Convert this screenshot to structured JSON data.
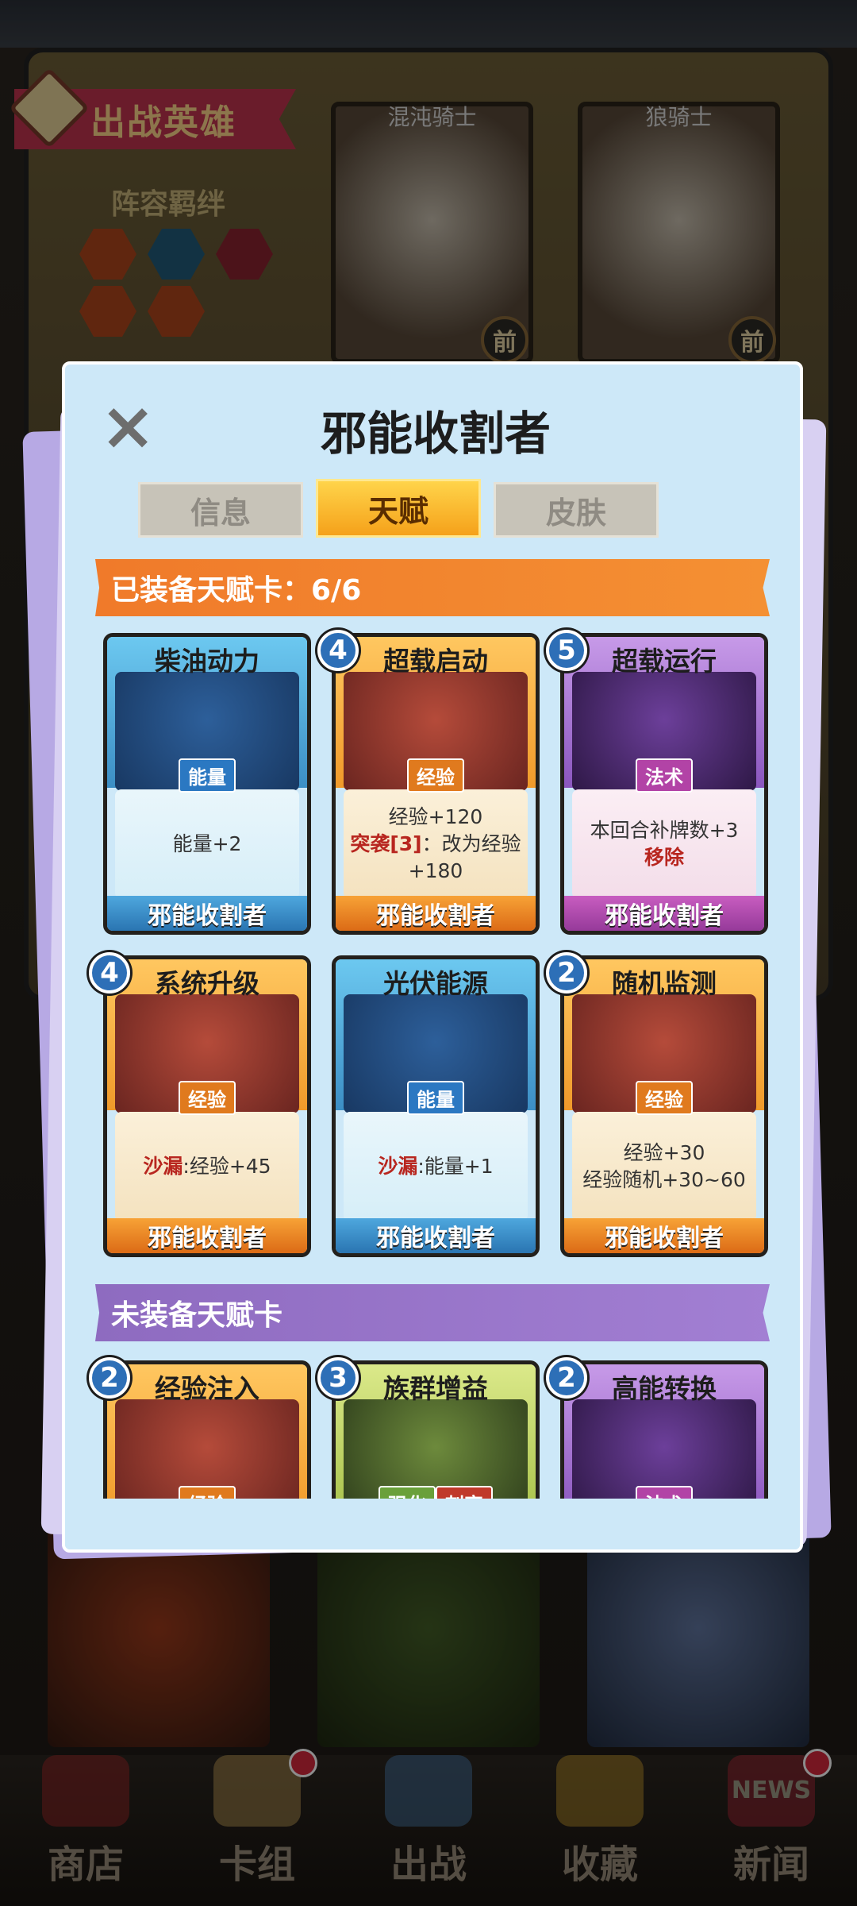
{
  "background": {
    "banner_label": "出战英雄",
    "team_bond_label": "阵容羁绊",
    "heroes": [
      {
        "name": "混沌骑士",
        "position_tag": "前"
      },
      {
        "name": "狼骑士",
        "position_tag": "前"
      }
    ]
  },
  "bottom_nav": {
    "items": [
      {
        "label": "商店",
        "icon": "shop-icon",
        "badge": false
      },
      {
        "label": "卡组",
        "icon": "deck-icon",
        "badge": true
      },
      {
        "label": "出战",
        "icon": "battle-swords-icon",
        "badge": false
      },
      {
        "label": "收藏",
        "icon": "collection-chest-icon",
        "badge": false
      },
      {
        "label": "新闻",
        "icon": "news-tv-icon",
        "badge": true,
        "icon_text": "NEWS"
      }
    ]
  },
  "modal": {
    "title": "邪能收割者",
    "tabs": [
      {
        "label": "信息",
        "active": false
      },
      {
        "label": "天赋",
        "active": true
      },
      {
        "label": "皮肤",
        "active": false
      }
    ],
    "equipped_header": "已装备天赋卡：6/6",
    "unequipped_header": "未装备天赋卡",
    "equipped_cards": [
      {
        "name": "柴油动力",
        "cost": null,
        "tag": "能量",
        "color": "blue",
        "desc_lines": [
          "能量+2"
        ],
        "owner": "邪能收割者"
      },
      {
        "name": "超载启动",
        "cost": "4",
        "tag": "经验",
        "color": "orange",
        "desc_lines": [
          "经验+120"
        ],
        "desc_highlight": "突袭[3]",
        "desc_after": "：改为经验+180",
        "owner": "邪能收割者"
      },
      {
        "name": "超载运行",
        "cost": "5",
        "tag": "法术",
        "color": "purple",
        "desc_lines": [
          "本回合补牌数+3"
        ],
        "desc_highlight": "移除",
        "owner": "邪能收割者"
      },
      {
        "name": "系统升级",
        "cost": "4",
        "tag": "经验",
        "color": "orange",
        "desc_highlight": "沙漏",
        "desc_after": ":经验+45",
        "owner": "邪能收割者"
      },
      {
        "name": "光伏能源",
        "cost": null,
        "tag": "能量",
        "color": "blue",
        "desc_highlight": "沙漏",
        "desc_after": ":能量+1",
        "owner": "邪能收割者"
      },
      {
        "name": "随机监测",
        "cost": "2",
        "tag": "经验",
        "color": "orange",
        "desc_lines": [
          "经验+30",
          "经验随机+30~60"
        ],
        "owner": "邪能收割者"
      }
    ],
    "unequipped_cards": [
      {
        "name": "经验注入",
        "cost": "2",
        "tags": [
          "经验"
        ],
        "color": "orange"
      },
      {
        "name": "族群增益",
        "cost": "3",
        "tags": [
          "强化",
          "刺客"
        ],
        "color": "green"
      },
      {
        "name": "高能转换",
        "cost": "2",
        "tags": [
          "法术"
        ],
        "color": "purple"
      }
    ]
  }
}
